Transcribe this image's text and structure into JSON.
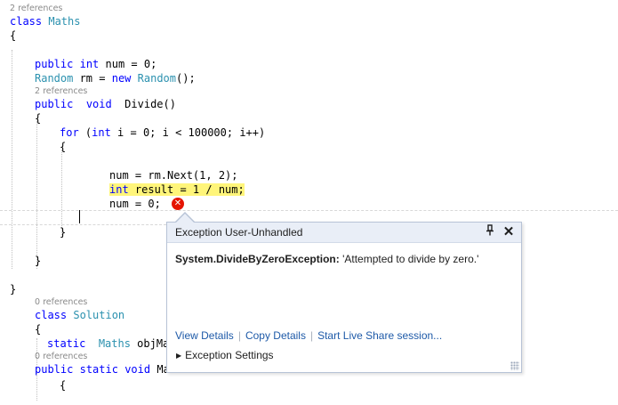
{
  "editor": {
    "codelens": {
      "maths_refs": "2 references",
      "divide_refs": "2 references",
      "solution_refs": "0 references",
      "main_refs": "0 references"
    },
    "lines": {
      "class_kw": "class",
      "class_name": "Maths",
      "open_brace": "{",
      "num_decl_kw1": "public",
      "num_decl_kw2": "int",
      "num_decl_rest": " num = 0;",
      "random_type": "Random",
      "random_var": " rm = ",
      "random_new": "new",
      "random_type2": "Random",
      "random_tail": "();",
      "divide_kw1": "public",
      "divide_kw2": "void",
      "divide_name": "Divide()",
      "for_kw": "for",
      "for_open": " (",
      "for_int": "int",
      "for_rest": " i = 0; i < 100000; i++)",
      "for_brace": "{",
      "next_stmt": "num = rm.Next(1, 2);",
      "result_kw": "int",
      "result_rest": " result = 1 / num;",
      "reset_stmt": "num = 0;",
      "for_close": "}",
      "method_close": "}",
      "class_close": "}",
      "solution_kw": "class",
      "solution_name": "Solution",
      "solution_brace": "{",
      "static_kw": "static",
      "static_type": "Maths",
      "static_var": " objMa",
      "main_kw1": "public",
      "main_kw2": "static",
      "main_kw3": "void",
      "main_name": " Ma",
      "main_brace": "{"
    }
  },
  "exception_popup": {
    "title": "Exception User-Unhandled",
    "pin_icon": "pin-icon",
    "close_icon": "close-icon",
    "exception_type": "System.DivideByZeroException:",
    "exception_message": " 'Attempted to divide by zero.'",
    "links": [
      "View Details",
      "Copy Details",
      "Start Live Share session..."
    ],
    "settings_label": "Exception Settings"
  },
  "colors": {
    "keyword": "#0000ff",
    "type": "#2b91af",
    "highlight": "#fff57a",
    "error": "#e51400",
    "link": "#1e5aa8"
  }
}
